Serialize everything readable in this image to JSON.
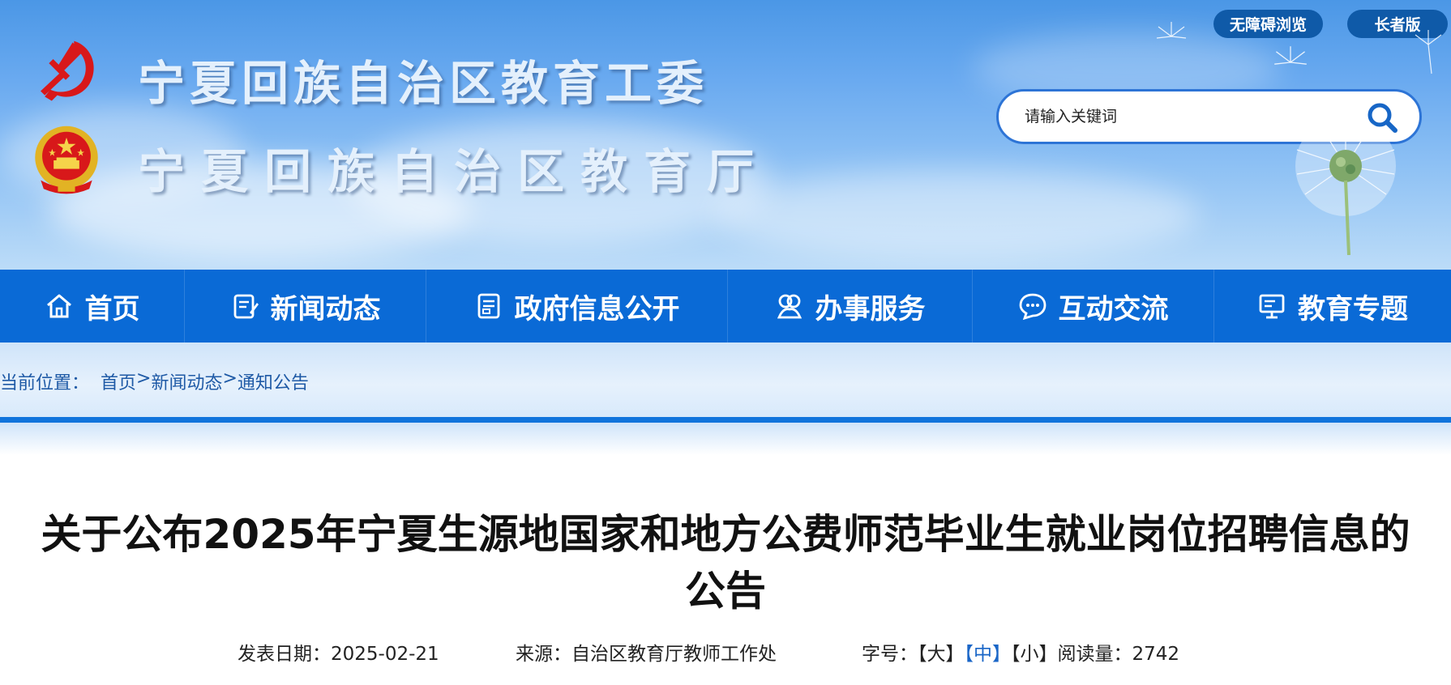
{
  "header": {
    "title_line1": "宁夏回族自治区教育工委",
    "title_line2": "宁夏回族自治区教育厅",
    "accessibility_label": "无障碍浏览",
    "elder_label": "长者版"
  },
  "search": {
    "placeholder": "请输入关键词"
  },
  "nav": {
    "items": [
      {
        "label": "首页",
        "icon": "home-icon"
      },
      {
        "label": "新闻动态",
        "icon": "news-icon"
      },
      {
        "label": "政府信息公开",
        "icon": "document-icon"
      },
      {
        "label": "办事服务",
        "icon": "service-icon"
      },
      {
        "label": "互动交流",
        "icon": "chat-icon"
      },
      {
        "label": "教育专题",
        "icon": "monitor-icon"
      }
    ]
  },
  "breadcrumb": {
    "prefix": "当前位置：",
    "items": [
      "首页",
      "新闻动态",
      "通知公告"
    ],
    "separator": ">"
  },
  "article": {
    "title": "关于公布2025年宁夏生源地国家和地方公费师范毕业生就业岗位招聘信息的公告",
    "date_label": "发表日期：",
    "date": "2025-02-21",
    "source_label": "来源：",
    "source": "自治区教育厅教师工作处",
    "font_size_label": "字号：",
    "font_large": "【大】",
    "font_medium": "【中】",
    "font_small": "【小】",
    "views_label": "阅读量：",
    "views": "2742"
  },
  "colors": {
    "nav_bg": "#0a6ad6",
    "pill_bg": "#0f5aa8",
    "link_blue": "#1f5aa6",
    "active_font_size": "#1a66c7"
  }
}
